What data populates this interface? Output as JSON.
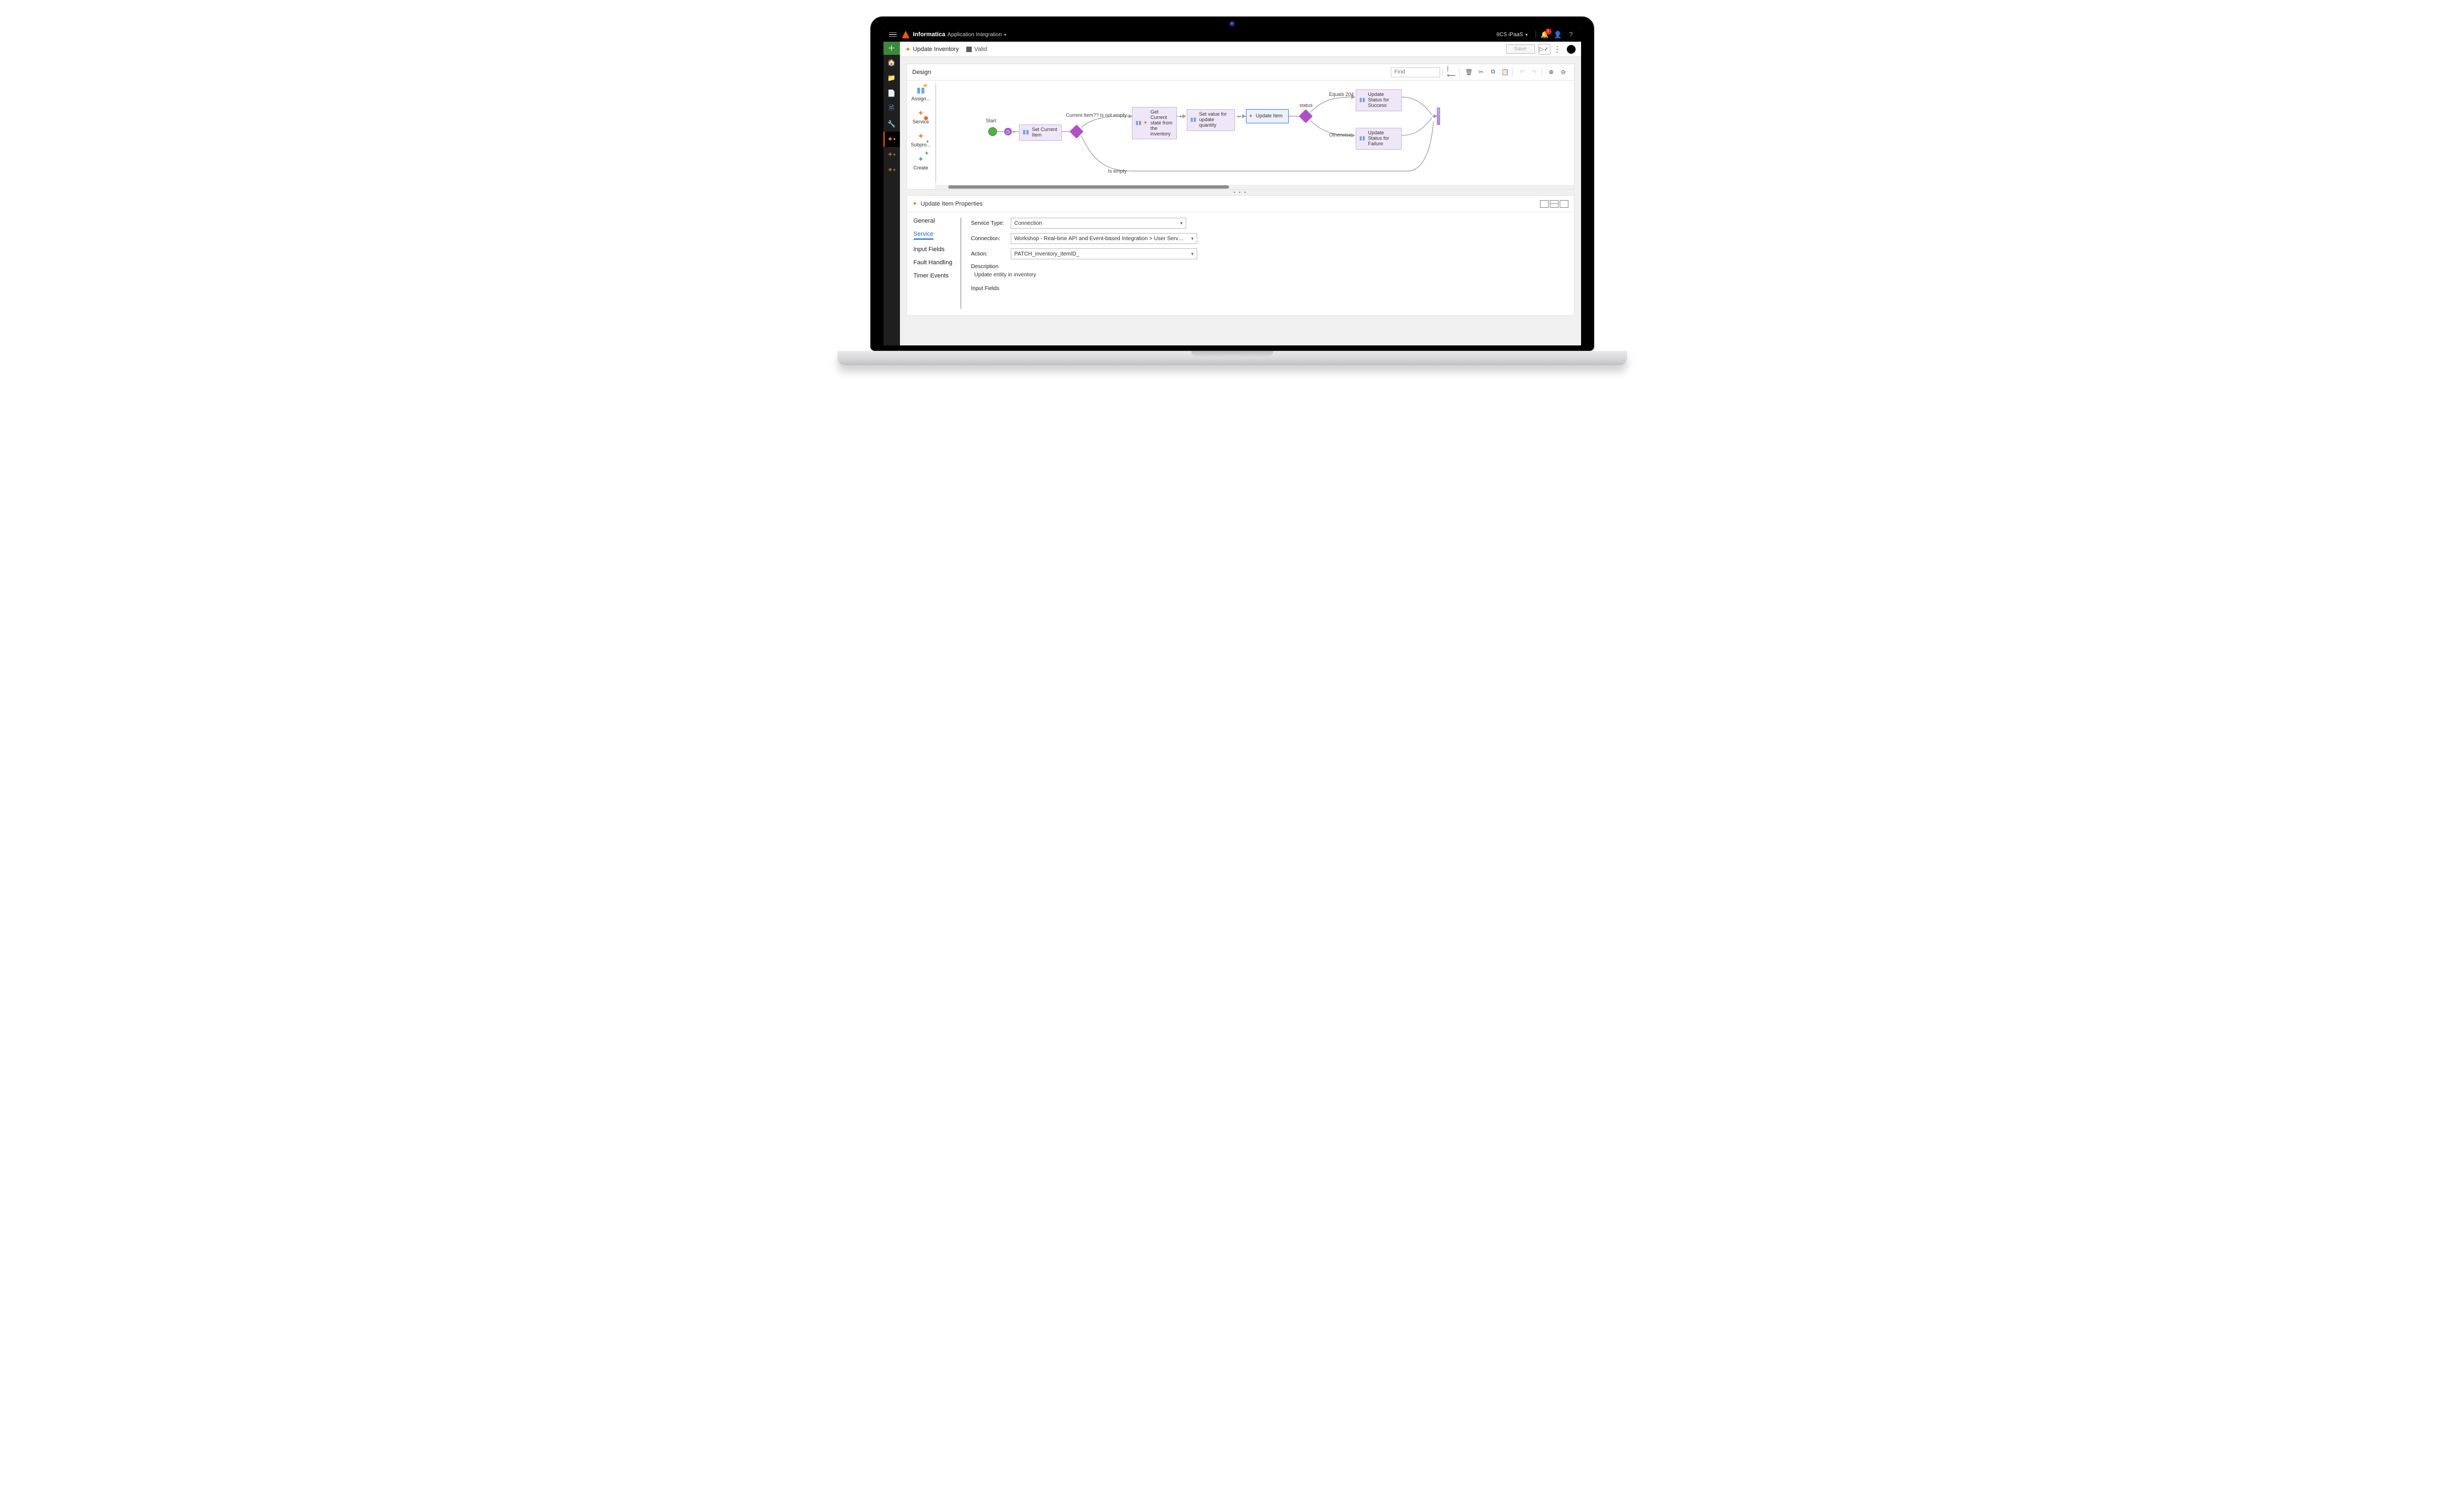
{
  "topbar": {
    "brand": "Informatica",
    "product": "Application Integration",
    "org": "IICS iPaaS",
    "bell_count": "1"
  },
  "rail": {
    "items": [
      "add",
      "home",
      "folder",
      "import",
      "document",
      "wrench",
      "process-active",
      "process",
      "process"
    ]
  },
  "tabheader": {
    "title": "Update Inventory",
    "status_label": "Valid",
    "save_label": "Save"
  },
  "design": {
    "panel_title": "Design",
    "find_placeholder": "Find",
    "palette": [
      {
        "label": "Assign...",
        "icon": "assign"
      },
      {
        "label": "Service",
        "icon": "service"
      },
      {
        "label": "Subpro...",
        "icon": "subpro"
      },
      {
        "label": "Create",
        "icon": "create"
      }
    ],
    "labels": {
      "start": "Start",
      "current_item_q": "Current Item??",
      "is_not_empty": "Is not empty",
      "is_empty": "Is empty",
      "status": "status",
      "equals_204": "Equals 204",
      "otherwise": "Otherwise"
    },
    "nodes": {
      "set_current_item": "Set Current Item",
      "get_current_state": "Get Current state from the inventory",
      "set_value_for_update": "Set value for update quantity",
      "update_item": "Update Item",
      "update_status_success": "Update Status for Success",
      "update_status_failure": "Update Status for Failure"
    }
  },
  "properties": {
    "title": "Update Item Properties",
    "tabs": [
      "General",
      "Service",
      "Input Fields",
      "Fault Handling",
      "Timer Events"
    ],
    "active_tab": "Service",
    "form": {
      "service_type_label": "Service Type:",
      "service_type_value": "Connection",
      "connection_label": "Connection:",
      "connection_value": "Workshop - Real-time API and Event-based Integration > User Services > Inventory-Data-S",
      "action_label": "Action:",
      "action_value": "PATCH_inventory_itemID_",
      "description_label": "Description",
      "description_value": "Update entity in inventory",
      "input_fields_label": "Input Fields"
    }
  }
}
